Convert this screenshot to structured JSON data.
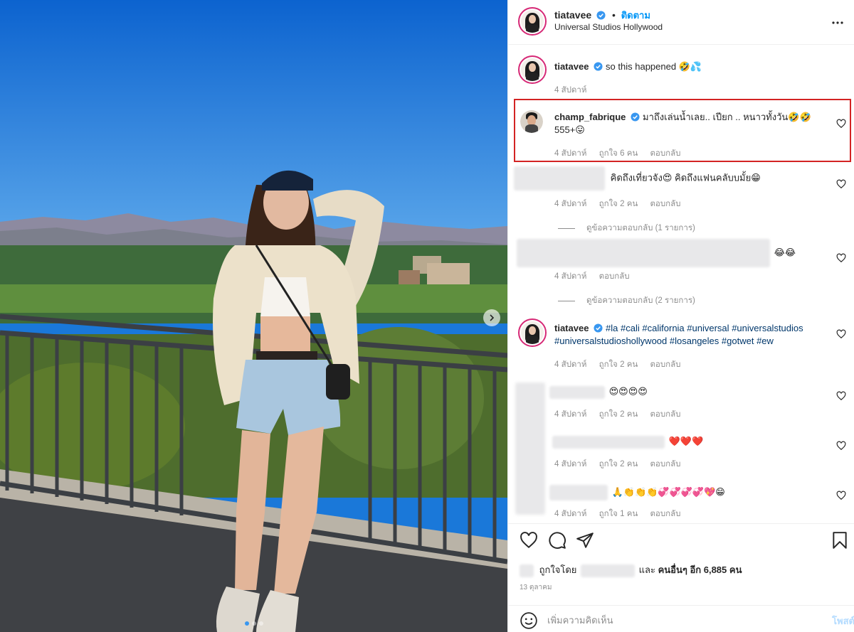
{
  "post": {
    "author": "tiatavee",
    "follow_label": "ติดตาม",
    "dot": "•",
    "location": "Universal Studios Hollywood",
    "more_icon": "more-horizontal-icon"
  },
  "comments": [
    {
      "user": "tiatavee",
      "text": "so this happened 🤣💦",
      "time": "4 สัปดาห์",
      "likes": "",
      "reply": ""
    },
    {
      "user": "champ_fabrique",
      "text": "มาถึงเล่นน้ำเลย.. เปียก .. หนาวทั้งวัน🤣🤣 555+😛",
      "time": "4 สัปดาห์",
      "likes": "ถูกใจ 6 คน",
      "reply": "ตอบกลับ"
    },
    {
      "user": "",
      "text": "คิดถึงเที่ยวจัง😍 คิดถึงแฟนคลับบมั้ย😁",
      "time": "4 สัปดาห์",
      "likes": "ถูกใจ 2 คน",
      "reply": "ตอบกลับ",
      "view_replies": "ดูข้อความตอบกลับ (1 รายการ)"
    },
    {
      "user": "",
      "text": "😂😂",
      "time": "4 สัปดาห์",
      "likes": "",
      "reply": "ตอบกลับ",
      "view_replies": "ดูข้อความตอบกลับ (2 รายการ)"
    },
    {
      "user": "tiatavee",
      "tags": [
        "#la",
        "#cali",
        "#california",
        "#universal",
        "#universalstudios",
        "#universalstudioshollywood",
        "#losangeles",
        "#gotwet",
        "#ew"
      ],
      "time": "4 สัปดาห์",
      "likes": "ถูกใจ 2 คน",
      "reply": "ตอบกลับ"
    },
    {
      "user": "",
      "text": "😍😍😍😍",
      "time": "4 สัปดาห์",
      "likes": "ถูกใจ 2 คน",
      "reply": "ตอบกลับ"
    },
    {
      "user": "",
      "text": "❤️❤️❤️",
      "time": "4 สัปดาห์",
      "likes": "ถูกใจ 2 คน",
      "reply": "ตอบกลับ"
    },
    {
      "user": "",
      "text": "🙏👏👏👏💞💞💞💞💖😁",
      "time": "4 สัปดาห์",
      "likes": "ถูกใจ 1 คน",
      "reply": "ตอบกลับ"
    }
  ],
  "actions": {
    "icons": [
      "heart-icon",
      "comment-icon",
      "share-icon",
      "bookmark-icon"
    ],
    "liked_by_prefix": "ถูกใจโดย",
    "liked_by_suffix": "และ",
    "others": "คนอื่นๆ อีก 6,885 คน",
    "date": "13 ตุลาคม"
  },
  "add_comment": {
    "placeholder": "เพิ่มความคิดเห็น",
    "post_label": "โพสต์"
  },
  "colors": {
    "accent": "#0095f6",
    "highlight": "#d32323",
    "muted": "#8e8e8e"
  }
}
